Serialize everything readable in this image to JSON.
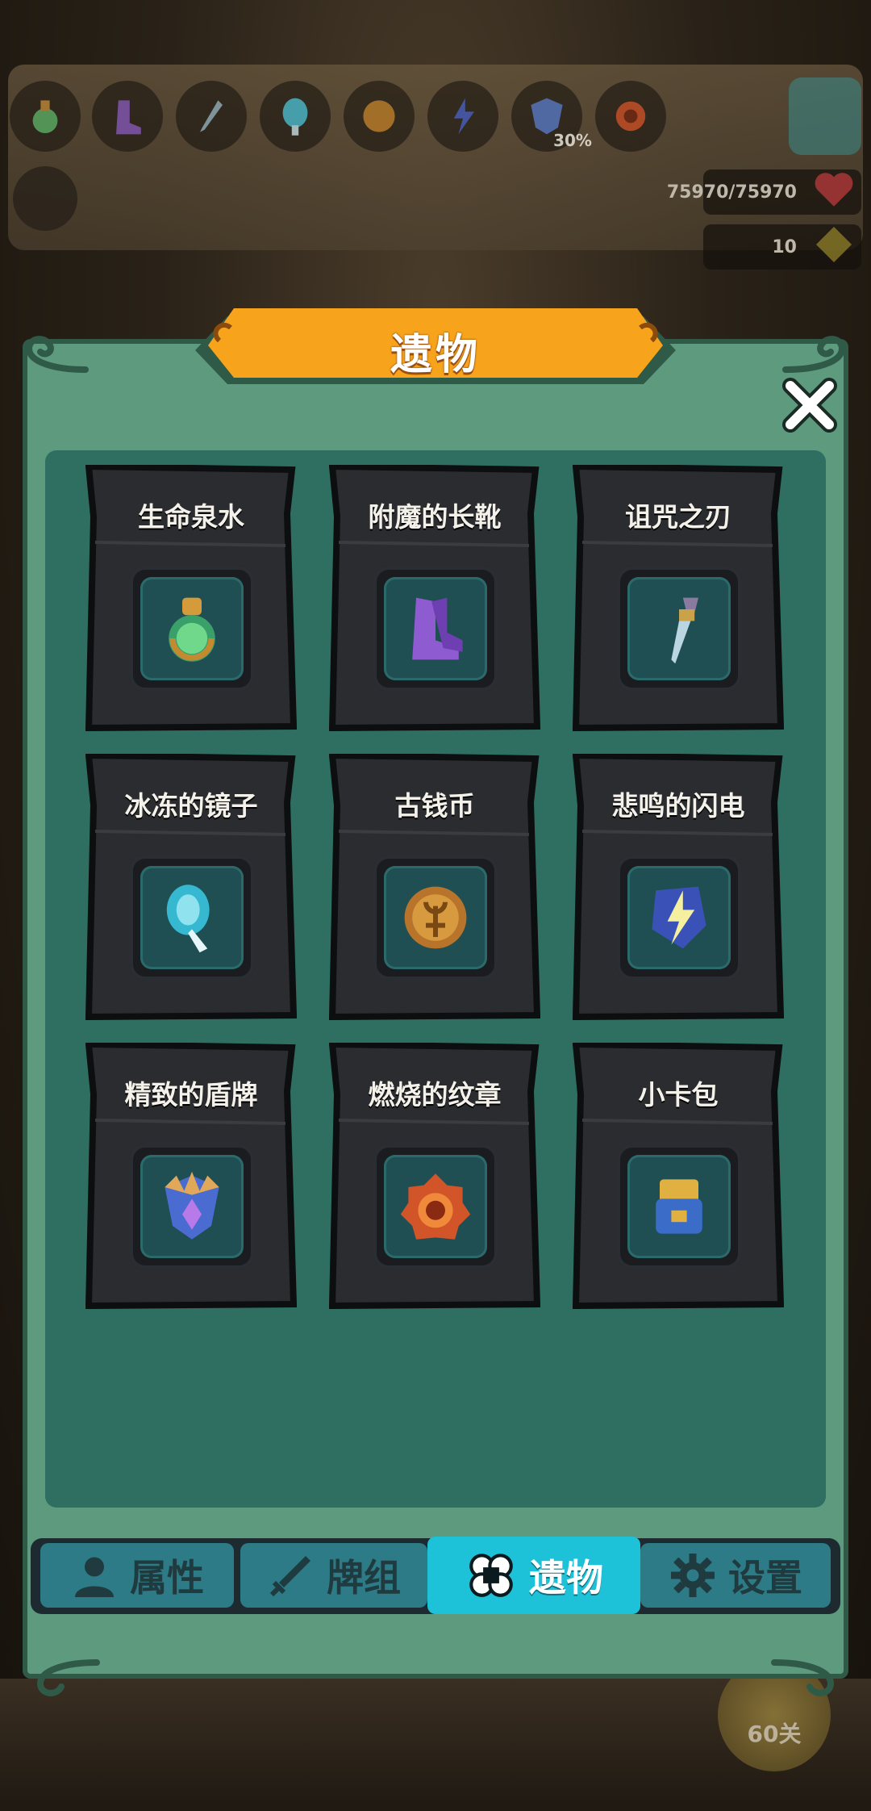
{
  "hud": {
    "top_relics": [
      {
        "icon": "potion-icon"
      },
      {
        "icon": "boots-icon"
      },
      {
        "icon": "dagger-icon"
      },
      {
        "icon": "mirror-icon"
      },
      {
        "icon": "coin-icon"
      },
      {
        "icon": "lightning-icon"
      },
      {
        "icon": "shield-icon"
      },
      {
        "icon": "emblem-icon"
      }
    ],
    "shield_percent": "30%",
    "health": "75970/75970",
    "energy": "10",
    "level": "60关"
  },
  "modal": {
    "title": "遗物",
    "close_icon": "close-icon"
  },
  "relics": [
    {
      "name": "生命泉水",
      "icon": "potion-icon"
    },
    {
      "name": "附魔的长靴",
      "icon": "boots-icon"
    },
    {
      "name": "诅咒之刃",
      "icon": "dagger-icon"
    },
    {
      "name": "冰冻的镜子",
      "icon": "mirror-icon"
    },
    {
      "name": "古钱币",
      "icon": "coin-icon"
    },
    {
      "name": "悲鸣的闪电",
      "icon": "lightning-icon"
    },
    {
      "name": "精致的盾牌",
      "icon": "shield-icon"
    },
    {
      "name": "燃烧的纹章",
      "icon": "emblem-icon"
    },
    {
      "name": "小卡包",
      "icon": "card-pack-icon"
    }
  ],
  "tabs": [
    {
      "label": "属性",
      "icon": "person-icon",
      "active": false
    },
    {
      "label": "牌组",
      "icon": "sword-icon",
      "active": false
    },
    {
      "label": "遗物",
      "icon": "clover-icon",
      "active": true
    },
    {
      "label": "设置",
      "icon": "gear-icon",
      "active": false
    }
  ],
  "colors": {
    "modal_green": "#5e9a7e",
    "inner_teal": "#2e6f62",
    "banner_orange": "#f7a31c",
    "tab_active": "#1ec2d8",
    "tab_inactive": "#2d7b86"
  }
}
